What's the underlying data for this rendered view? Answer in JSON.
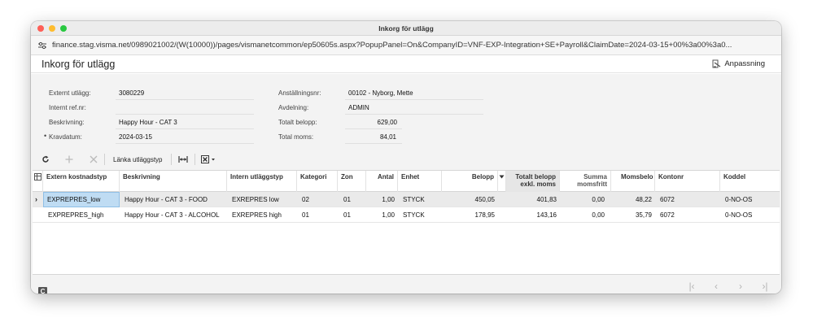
{
  "window": {
    "title": "Inkorg för utlägg"
  },
  "browser": {
    "url": "finance.stag.visma.net/0989021002/(W(10000))/pages/vismanetcommon/ep50605s.aspx?PopupPanel=On&CompanyID=VNF-EXP-Integration+SE+Payroll&ClaimDate=2024-03-15+00%3a00%3a0..."
  },
  "page": {
    "title": "Inkorg för utlägg",
    "customize_label": "Anpassning"
  },
  "form": {
    "external_expense_label": "Externt utlägg:",
    "external_expense_value": "3080229",
    "internal_ref_label": "Internt ref.nr:",
    "internal_ref_value": "",
    "description_label": "Beskrivning:",
    "description_value": "Happy Hour - CAT 3",
    "claim_date_label": "Kravdatum:",
    "claim_date_value": "2024-03-15",
    "employee_no_label": "Anställningsnr:",
    "employee_no_value": "00102 - Nyborg, Mette",
    "department_label": "Avdelning:",
    "department_value": "ADMIN",
    "total_amount_label": "Totalt belopp:",
    "total_amount_value": "629,00",
    "total_vat_label": "Total moms:",
    "total_vat_value": "84,01"
  },
  "toolbar": {
    "link_expense_type_label": "Länka utläggstyp"
  },
  "grid": {
    "headers": {
      "ext_cost_type": "Extern kostnadstyp",
      "description": "Beskrivning",
      "int_expense_type": "Intern utläggstyp",
      "category": "Kategori",
      "zone": "Zon",
      "quantity": "Antal",
      "unit": "Enhet",
      "amount": "Belopp",
      "total_ex_vat_1": "Totalt belopp",
      "total_ex_vat_2": "exkl. moms",
      "vat_free_1": "Summa",
      "vat_free_2": "momsfritt",
      "vat_amount": "Momsbelo",
      "account": "Kontonr",
      "code": "Koddel"
    },
    "rows": [
      {
        "ext_cost_type": "EXPREPRES_low",
        "description": "Happy Hour - CAT 3 - FOOD",
        "int_expense_type": "EXREPRES low",
        "category": "02",
        "zone": "01",
        "quantity": "1,00",
        "unit": "STYCK",
        "amount": "450,05",
        "total_ex_vat": "401,83",
        "vat_free": "0,00",
        "vat_amount": "48,22",
        "account": "6072",
        "code": "0-NO-OS"
      },
      {
        "ext_cost_type": "EXPREPRES_high",
        "description": "Happy Hour - CAT 3 - ALCOHOL",
        "int_expense_type": "EXREPRES high",
        "category": "01",
        "zone": "01",
        "quantity": "1,00",
        "unit": "STYCK",
        "amount": "178,95",
        "total_ex_vat": "143,16",
        "vat_free": "0,00",
        "vat_amount": "35,79",
        "account": "6072",
        "code": "0-NO-OS"
      }
    ]
  },
  "footer": {
    "c_badge": "C"
  },
  "pager": {
    "first": "|‹",
    "prev": "‹",
    "next": "›",
    "last": "›|"
  }
}
